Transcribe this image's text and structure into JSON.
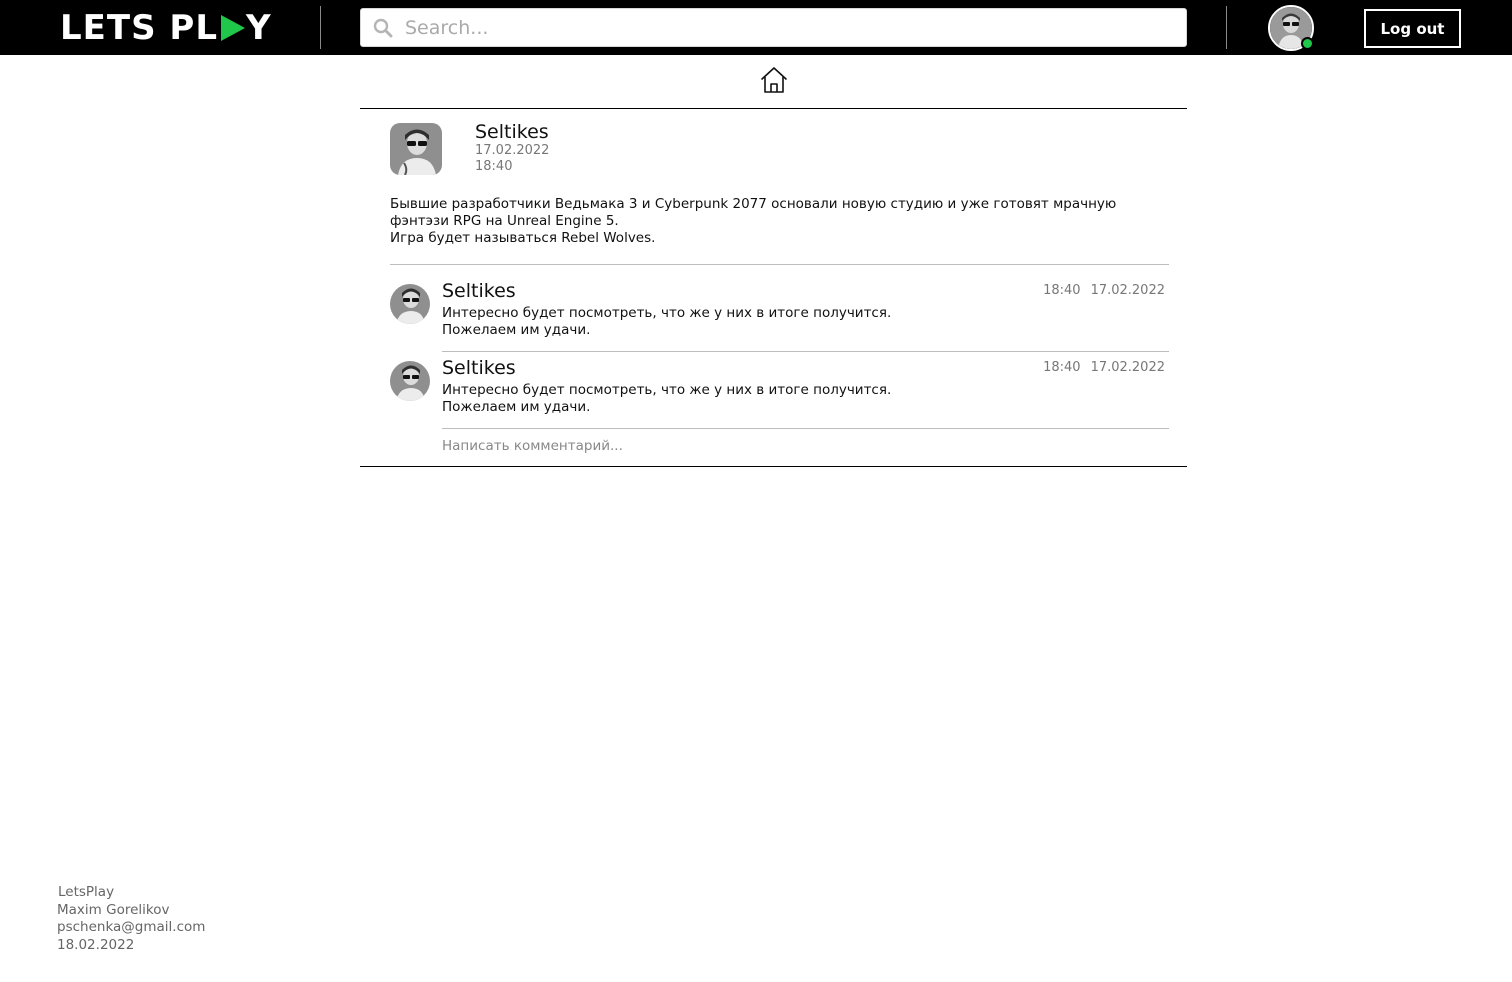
{
  "header": {
    "logo_text_left": "LETS PL",
    "logo_text_right": "Y",
    "search": {
      "placeholder": "Search...",
      "value": ""
    },
    "logout_label": "Log out",
    "status": "online",
    "colors": {
      "brand_accent": "#1fc74a",
      "bar_bg": "#000000"
    }
  },
  "nav": {
    "home_icon": "home-icon"
  },
  "post": {
    "author": "Seltikes",
    "date": "17.02.2022",
    "time": "18:40",
    "text_lines": [
      "Бывшие разработчики Ведьмака 3 и  Cyberpunk 2077 основали новую студию и уже готовят мрачную",
      "фэнтэзи RPG на Unreal Engine 5.",
      "Игра будет называться Rebel Wolves."
    ]
  },
  "comments": [
    {
      "author": "Seltikes",
      "time": "18:40",
      "date": "17.02.2022",
      "line1": "Интересно будет посмотреть, что же у них в итоге получится.",
      "line2": "Пожелаем им удачи."
    },
    {
      "author": "Seltikes",
      "time": "18:40",
      "date": "17.02.2022",
      "line1": "Интересно будет посмотреть, что же у них в итоге получится.",
      "line2": "Пожелаем им удачи."
    }
  ],
  "comment_input": {
    "placeholder": "Написать комментарий...",
    "value": ""
  },
  "footer": {
    "app": "LetsPlay",
    "author": "Maxim Gorelikov",
    "email": "pschenka@gmail.com",
    "date": "18.02.2022"
  }
}
